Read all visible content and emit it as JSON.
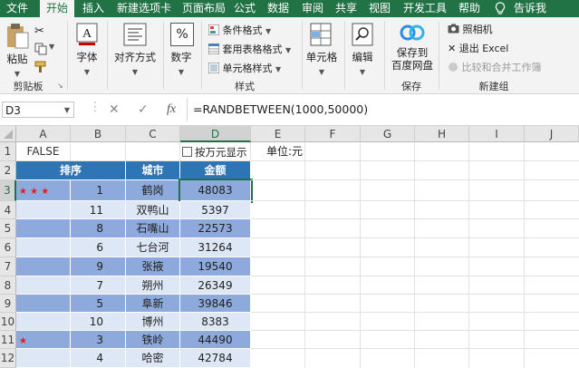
{
  "tabs": [
    "文件",
    "开始",
    "插入",
    "新建选项卡",
    "页面布局",
    "公式",
    "数据",
    "审阅",
    "共享",
    "视图",
    "开发工具",
    "帮助",
    "告诉我"
  ],
  "ribbon": {
    "paste": "粘贴",
    "clipboard": "剪贴板",
    "font": "字体",
    "align": "对齐方式",
    "number": "数字",
    "number_symbol": "%",
    "cond_format": "条件格式",
    "table_format": "套用表格格式",
    "cell_style": "单元格样式",
    "styles": "样式",
    "cells": "单元格",
    "edit": "编辑",
    "save_to": "保存到",
    "baidu": "百度网盘",
    "save": "保存",
    "camera": "照相机",
    "exit_excel": "退出 Excel",
    "compare_merge": "比较和合并工作簿",
    "new_group": "新建组"
  },
  "formula_bar": {
    "name_box": "D3",
    "fx": "fx",
    "formula": "=RANDBETWEEN(1000,50000)"
  },
  "columns": [
    "A",
    "B",
    "C",
    "D",
    "E",
    "F",
    "G",
    "H",
    "I",
    "J"
  ],
  "rows": [
    "1",
    "2",
    "3",
    "4",
    "5",
    "6",
    "7",
    "8",
    "9",
    "10",
    "11",
    "12"
  ],
  "cells": {
    "a1": "FALSE",
    "d1_checkbox": "按万元显示",
    "e1": "单位:元",
    "headers": {
      "rank": "排序",
      "city": "城市",
      "amount": "金额"
    }
  },
  "table": [
    {
      "stars": "★ ★ ★",
      "rank": "1",
      "city": "鹤岗",
      "amount": "48083"
    },
    {
      "stars": "",
      "rank": "11",
      "city": "双鸭山",
      "amount": "5397"
    },
    {
      "stars": "",
      "rank": "8",
      "city": "石嘴山",
      "amount": "22573"
    },
    {
      "stars": "",
      "rank": "6",
      "city": "七台河",
      "amount": "31264"
    },
    {
      "stars": "",
      "rank": "9",
      "city": "张掖",
      "amount": "19540"
    },
    {
      "stars": "",
      "rank": "7",
      "city": "朔州",
      "amount": "26349"
    },
    {
      "stars": "",
      "rank": "5",
      "city": "阜新",
      "amount": "39846"
    },
    {
      "stars": "",
      "rank": "10",
      "city": "博州",
      "amount": "8383"
    },
    {
      "stars": "★",
      "rank": "3",
      "city": "铁岭",
      "amount": "44490"
    },
    {
      "stars": "",
      "rank": "4",
      "city": "哈密",
      "amount": "42784"
    }
  ],
  "colors": {
    "excel_green": "#217346",
    "header_blue": "#2e75b6",
    "row_dark": "#8ea9db",
    "row_light": "#dde7f5",
    "star_red": "#dd2222"
  }
}
